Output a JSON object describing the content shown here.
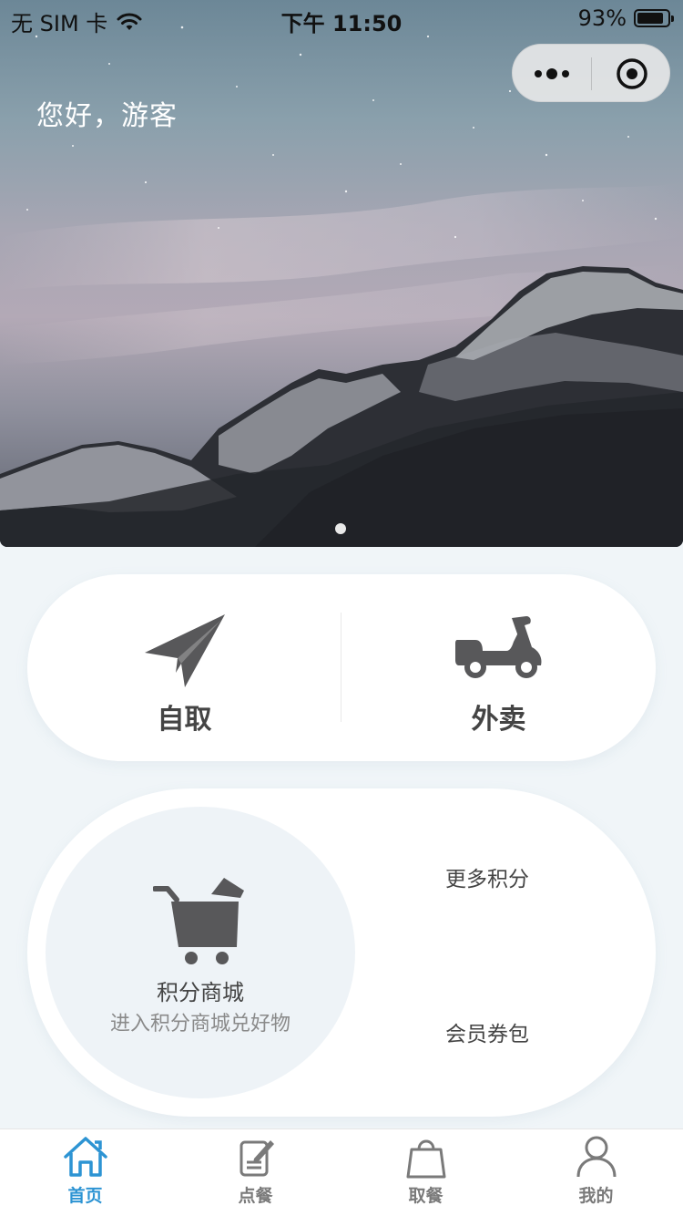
{
  "status_bar": {
    "carrier": "无 SIM 卡",
    "time": "下午 11:50",
    "battery": "93%"
  },
  "header": {
    "greeting": "您好，游客"
  },
  "banner": {
    "image": "starry-mountain-landscape",
    "active_slide": 1,
    "slide_count": 1
  },
  "order_options": [
    {
      "label": "自取",
      "icon": "paper-plane-icon"
    },
    {
      "label": "外卖",
      "icon": "scooter-icon"
    }
  ],
  "points": {
    "mall_title": "积分商城",
    "mall_subtitle": "进入积分商城兑好物",
    "mall_icon": "shopping-cart-icon",
    "more_points": "更多积分",
    "coupon_pack": "会员券包"
  },
  "tab_bar": {
    "active_index": 0,
    "items": [
      {
        "label": "首页",
        "icon": "home-icon"
      },
      {
        "label": "点餐",
        "icon": "order-edit-icon"
      },
      {
        "label": "取餐",
        "icon": "shopping-bag-icon"
      },
      {
        "label": "我的",
        "icon": "user-icon"
      }
    ]
  },
  "colors": {
    "accent": "#2d94d3",
    "icon_gray": "#58585a",
    "background": "#f0f5f8"
  }
}
